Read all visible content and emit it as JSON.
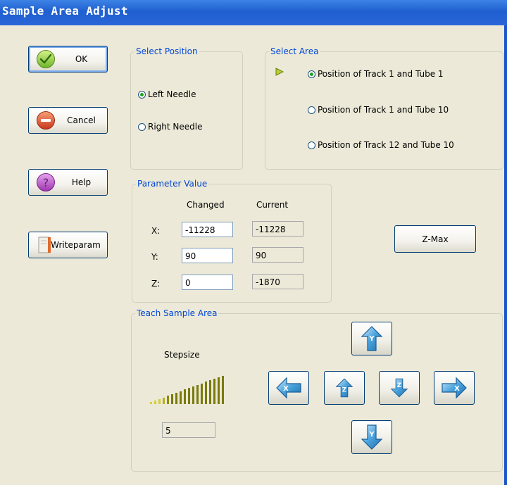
{
  "window": {
    "title": "Sample Area Adjust"
  },
  "buttons": {
    "ok": "OK",
    "cancel": "Cancel",
    "help": "Help",
    "writeparam": "Writeparam",
    "zmax": "Z-Max"
  },
  "select_position": {
    "legend": "Select Position",
    "options": [
      {
        "label": "Left Needle",
        "selected": true
      },
      {
        "label": "Right Needle",
        "selected": false
      }
    ]
  },
  "select_area": {
    "legend": "Select Area",
    "options": [
      {
        "label": "Position of Track 1 and Tube 1",
        "selected": true
      },
      {
        "label": "Position of Track 1 and Tube 10",
        "selected": false
      },
      {
        "label": "Position of Track 12 and Tube 10",
        "selected": false
      }
    ]
  },
  "parameter_value": {
    "legend": "Parameter Value",
    "col_changed": "Changed",
    "col_current": "Current",
    "rows": [
      {
        "axis": "X:",
        "changed": "-11228",
        "current": "-11228"
      },
      {
        "axis": "Y:",
        "changed": "90",
        "current": "90"
      },
      {
        "axis": "Z:",
        "changed": "0",
        "current": "-1870"
      }
    ]
  },
  "teach": {
    "legend": "Teach Sample Area",
    "stepsize_label": "Stepsize",
    "stepsize_value": "5"
  },
  "colors": {
    "title_bar": "#2a66d8",
    "legend_text": "#0046d5",
    "step_bars": "#7a7a0a",
    "arrow_blue": "#2f86c8"
  },
  "icons": [
    "check-icon",
    "minus-icon",
    "question-icon",
    "writeparam-icon",
    "arrow-up-icon",
    "arrow-down-icon",
    "arrow-left-icon",
    "arrow-right-icon",
    "z-up-icon",
    "z-down-icon",
    "selection-marker-icon"
  ]
}
